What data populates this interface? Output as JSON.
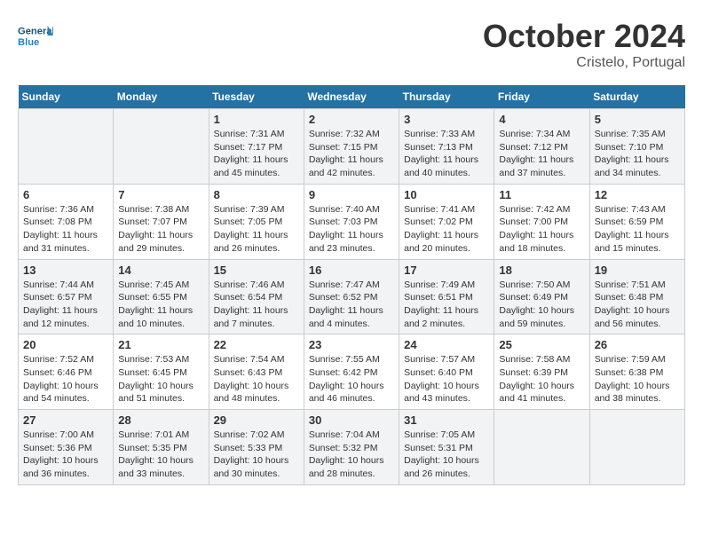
{
  "header": {
    "logo_general": "General",
    "logo_blue": "Blue",
    "month_title": "October 2024",
    "subtitle": "Cristelo, Portugal"
  },
  "weekdays": [
    "Sunday",
    "Monday",
    "Tuesday",
    "Wednesday",
    "Thursday",
    "Friday",
    "Saturday"
  ],
  "weeks": [
    [
      {
        "day": "",
        "sunrise": "",
        "sunset": "",
        "daylight": ""
      },
      {
        "day": "",
        "sunrise": "",
        "sunset": "",
        "daylight": ""
      },
      {
        "day": "1",
        "sunrise": "Sunrise: 7:31 AM",
        "sunset": "Sunset: 7:17 PM",
        "daylight": "Daylight: 11 hours and 45 minutes."
      },
      {
        "day": "2",
        "sunrise": "Sunrise: 7:32 AM",
        "sunset": "Sunset: 7:15 PM",
        "daylight": "Daylight: 11 hours and 42 minutes."
      },
      {
        "day": "3",
        "sunrise": "Sunrise: 7:33 AM",
        "sunset": "Sunset: 7:13 PM",
        "daylight": "Daylight: 11 hours and 40 minutes."
      },
      {
        "day": "4",
        "sunrise": "Sunrise: 7:34 AM",
        "sunset": "Sunset: 7:12 PM",
        "daylight": "Daylight: 11 hours and 37 minutes."
      },
      {
        "day": "5",
        "sunrise": "Sunrise: 7:35 AM",
        "sunset": "Sunset: 7:10 PM",
        "daylight": "Daylight: 11 hours and 34 minutes."
      }
    ],
    [
      {
        "day": "6",
        "sunrise": "Sunrise: 7:36 AM",
        "sunset": "Sunset: 7:08 PM",
        "daylight": "Daylight: 11 hours and 31 minutes."
      },
      {
        "day": "7",
        "sunrise": "Sunrise: 7:38 AM",
        "sunset": "Sunset: 7:07 PM",
        "daylight": "Daylight: 11 hours and 29 minutes."
      },
      {
        "day": "8",
        "sunrise": "Sunrise: 7:39 AM",
        "sunset": "Sunset: 7:05 PM",
        "daylight": "Daylight: 11 hours and 26 minutes."
      },
      {
        "day": "9",
        "sunrise": "Sunrise: 7:40 AM",
        "sunset": "Sunset: 7:03 PM",
        "daylight": "Daylight: 11 hours and 23 minutes."
      },
      {
        "day": "10",
        "sunrise": "Sunrise: 7:41 AM",
        "sunset": "Sunset: 7:02 PM",
        "daylight": "Daylight: 11 hours and 20 minutes."
      },
      {
        "day": "11",
        "sunrise": "Sunrise: 7:42 AM",
        "sunset": "Sunset: 7:00 PM",
        "daylight": "Daylight: 11 hours and 18 minutes."
      },
      {
        "day": "12",
        "sunrise": "Sunrise: 7:43 AM",
        "sunset": "Sunset: 6:59 PM",
        "daylight": "Daylight: 11 hours and 15 minutes."
      }
    ],
    [
      {
        "day": "13",
        "sunrise": "Sunrise: 7:44 AM",
        "sunset": "Sunset: 6:57 PM",
        "daylight": "Daylight: 11 hours and 12 minutes."
      },
      {
        "day": "14",
        "sunrise": "Sunrise: 7:45 AM",
        "sunset": "Sunset: 6:55 PM",
        "daylight": "Daylight: 11 hours and 10 minutes."
      },
      {
        "day": "15",
        "sunrise": "Sunrise: 7:46 AM",
        "sunset": "Sunset: 6:54 PM",
        "daylight": "Daylight: 11 hours and 7 minutes."
      },
      {
        "day": "16",
        "sunrise": "Sunrise: 7:47 AM",
        "sunset": "Sunset: 6:52 PM",
        "daylight": "Daylight: 11 hours and 4 minutes."
      },
      {
        "day": "17",
        "sunrise": "Sunrise: 7:49 AM",
        "sunset": "Sunset: 6:51 PM",
        "daylight": "Daylight: 11 hours and 2 minutes."
      },
      {
        "day": "18",
        "sunrise": "Sunrise: 7:50 AM",
        "sunset": "Sunset: 6:49 PM",
        "daylight": "Daylight: 10 hours and 59 minutes."
      },
      {
        "day": "19",
        "sunrise": "Sunrise: 7:51 AM",
        "sunset": "Sunset: 6:48 PM",
        "daylight": "Daylight: 10 hours and 56 minutes."
      }
    ],
    [
      {
        "day": "20",
        "sunrise": "Sunrise: 7:52 AM",
        "sunset": "Sunset: 6:46 PM",
        "daylight": "Daylight: 10 hours and 54 minutes."
      },
      {
        "day": "21",
        "sunrise": "Sunrise: 7:53 AM",
        "sunset": "Sunset: 6:45 PM",
        "daylight": "Daylight: 10 hours and 51 minutes."
      },
      {
        "day": "22",
        "sunrise": "Sunrise: 7:54 AM",
        "sunset": "Sunset: 6:43 PM",
        "daylight": "Daylight: 10 hours and 48 minutes."
      },
      {
        "day": "23",
        "sunrise": "Sunrise: 7:55 AM",
        "sunset": "Sunset: 6:42 PM",
        "daylight": "Daylight: 10 hours and 46 minutes."
      },
      {
        "day": "24",
        "sunrise": "Sunrise: 7:57 AM",
        "sunset": "Sunset: 6:40 PM",
        "daylight": "Daylight: 10 hours and 43 minutes."
      },
      {
        "day": "25",
        "sunrise": "Sunrise: 7:58 AM",
        "sunset": "Sunset: 6:39 PM",
        "daylight": "Daylight: 10 hours and 41 minutes."
      },
      {
        "day": "26",
        "sunrise": "Sunrise: 7:59 AM",
        "sunset": "Sunset: 6:38 PM",
        "daylight": "Daylight: 10 hours and 38 minutes."
      }
    ],
    [
      {
        "day": "27",
        "sunrise": "Sunrise: 7:00 AM",
        "sunset": "Sunset: 5:36 PM",
        "daylight": "Daylight: 10 hours and 36 minutes."
      },
      {
        "day": "28",
        "sunrise": "Sunrise: 7:01 AM",
        "sunset": "Sunset: 5:35 PM",
        "daylight": "Daylight: 10 hours and 33 minutes."
      },
      {
        "day": "29",
        "sunrise": "Sunrise: 7:02 AM",
        "sunset": "Sunset: 5:33 PM",
        "daylight": "Daylight: 10 hours and 30 minutes."
      },
      {
        "day": "30",
        "sunrise": "Sunrise: 7:04 AM",
        "sunset": "Sunset: 5:32 PM",
        "daylight": "Daylight: 10 hours and 28 minutes."
      },
      {
        "day": "31",
        "sunrise": "Sunrise: 7:05 AM",
        "sunset": "Sunset: 5:31 PM",
        "daylight": "Daylight: 10 hours and 26 minutes."
      },
      {
        "day": "",
        "sunrise": "",
        "sunset": "",
        "daylight": ""
      },
      {
        "day": "",
        "sunrise": "",
        "sunset": "",
        "daylight": ""
      }
    ]
  ]
}
